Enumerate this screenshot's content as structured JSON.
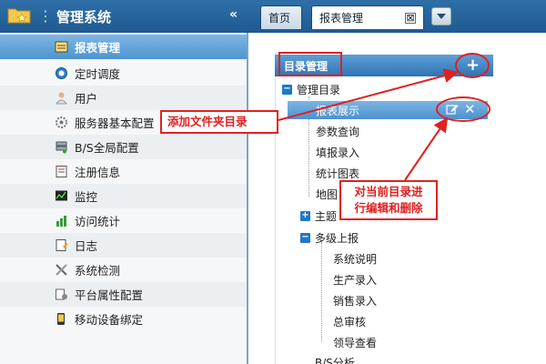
{
  "app": {
    "title": "管理系统",
    "collapse_symbol": "«"
  },
  "tabs": [
    {
      "label": "首页"
    },
    {
      "label": "报表管理",
      "close_symbol": "⊠"
    }
  ],
  "sidebar": {
    "items": [
      {
        "label": "报表管理",
        "icon": "report-icon",
        "active": true
      },
      {
        "label": "定时调度",
        "icon": "clock-icon"
      },
      {
        "label": "用户",
        "icon": "user-icon"
      },
      {
        "label": "服务器基本配置",
        "icon": "gear-icon"
      },
      {
        "label": "B/S全局配置",
        "icon": "server-icon"
      },
      {
        "label": "注册信息",
        "icon": "register-icon"
      },
      {
        "label": "监控",
        "icon": "monitor-icon"
      },
      {
        "label": "访问统计",
        "icon": "chart-icon"
      },
      {
        "label": "日志",
        "icon": "log-icon"
      },
      {
        "label": "系统检测",
        "icon": "tools-icon"
      },
      {
        "label": "平台属性配置",
        "icon": "config-icon"
      },
      {
        "label": "移动设备绑定",
        "icon": "mobile-icon"
      }
    ]
  },
  "tree": {
    "header": "目录管理",
    "add_symbol": "+",
    "delete_symbol": "✕",
    "nodes": [
      {
        "label": "管理目录",
        "toggle": "−"
      },
      {
        "label": "报表展示"
      },
      {
        "label": "参数查询"
      },
      {
        "label": "填报录入"
      },
      {
        "label": "统计图表"
      },
      {
        "label": "地图"
      },
      {
        "label": "主题",
        "toggle": "+"
      },
      {
        "label": "多级上报",
        "toggle": "−"
      },
      {
        "label": "系统说明"
      },
      {
        "label": "生产录入"
      },
      {
        "label": "销售录入"
      },
      {
        "label": "总审核"
      },
      {
        "label": "领导查看"
      },
      {
        "label": "B/S分析"
      }
    ]
  },
  "annotations": {
    "add_folder": "添加文件夹目录",
    "edit_delete_line1": "对当前目录进",
    "edit_delete_line2": "行编辑和删除"
  },
  "colors": {
    "accent": "#2f6fa8",
    "selected": "#4c91cf",
    "annotation": "#e02020"
  }
}
